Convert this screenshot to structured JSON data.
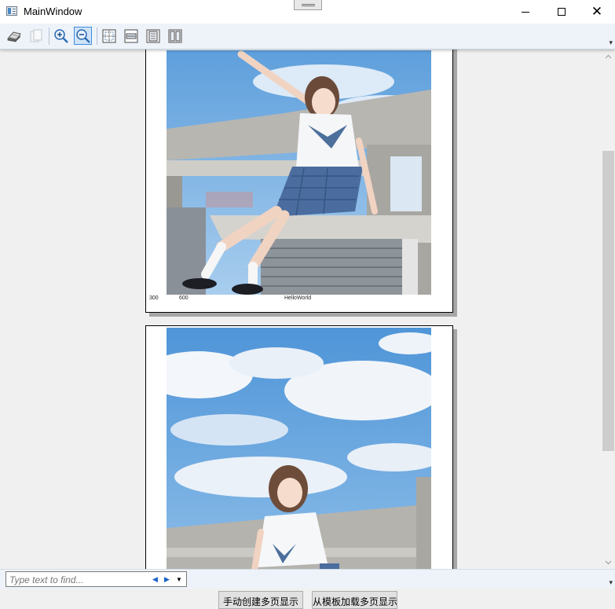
{
  "window": {
    "title": "MainWindow"
  },
  "toolbar": {
    "buttons": [
      {
        "name": "print-button",
        "icon": "printer-icon"
      },
      {
        "name": "copy-button",
        "icon": "copy-icon"
      },
      {
        "name": "zoom-in-button",
        "icon": "zoom-in-icon"
      },
      {
        "name": "zoom-out-button",
        "icon": "zoom-out-icon"
      },
      {
        "name": "actual-size-button",
        "icon": "actual-size-icon"
      },
      {
        "name": "page-width-button",
        "icon": "page-width-icon"
      },
      {
        "name": "whole-page-button",
        "icon": "whole-page-icon"
      },
      {
        "name": "two-pages-button",
        "icon": "two-pages-icon"
      }
    ]
  },
  "pages": [
    {
      "footer": {
        "left": "300",
        "mid": "600",
        "center": "HelloWorld"
      }
    },
    {}
  ],
  "find": {
    "placeholder": "Type text to find..."
  },
  "buttons": {
    "manual": "手动创建多页显示",
    "template": "从模板加载多页显示"
  },
  "colors": {
    "toolbar_bg": "#eef3fa",
    "sky": "#6aa7e0",
    "scroll_thumb": "#cdcdcd"
  }
}
